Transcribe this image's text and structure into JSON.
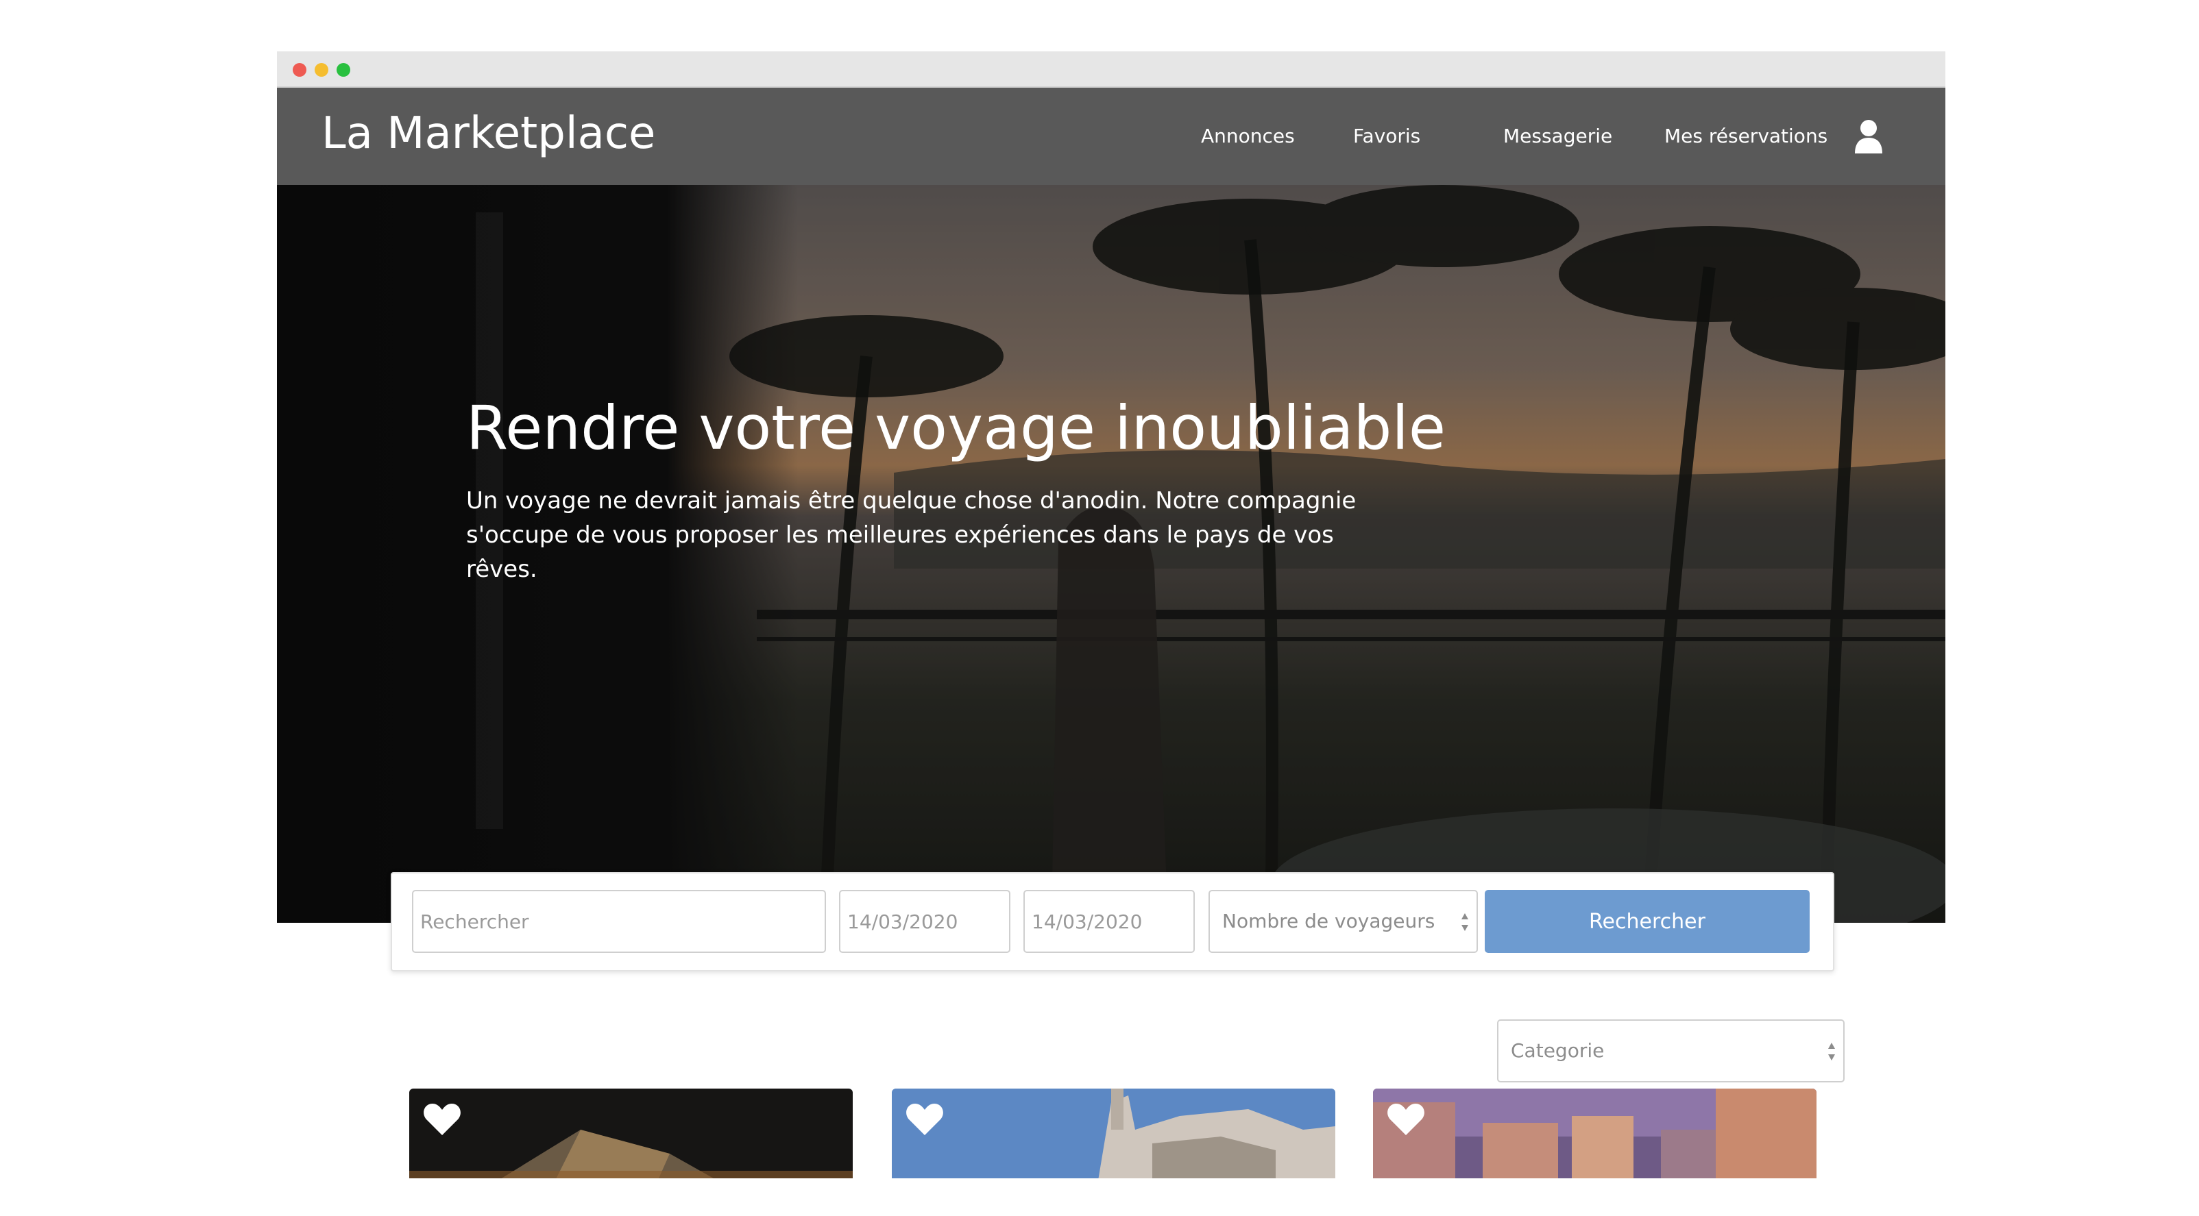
{
  "nav": {
    "brand": "La Marketplace",
    "links": [
      "Annonces",
      "Favoris",
      "Messagerie",
      "Mes réservations"
    ],
    "user_icon": "user-icon"
  },
  "hero": {
    "title": "Rendre votre voyage inoubliable",
    "text": "Un voyage ne devrait jamais être quelque chose d'anodin. Notre compagnie s'occupe de vous proposer les meilleures expériences dans le pays de vos rêves."
  },
  "search": {
    "query_placeholder": "Rechercher",
    "date_start": "14/03/2020",
    "date_end": "14/03/2020",
    "travellers_placeholder": "Nombre de voyageurs",
    "button_label": "Rechercher"
  },
  "filter": {
    "category_placeholder": "Categorie"
  },
  "cards": [
    {
      "favorite_icon": "heart-icon"
    },
    {
      "favorite_icon": "heart-icon"
    },
    {
      "favorite_icon": "heart-icon"
    }
  ],
  "colors": {
    "navbar": "#595959",
    "accent_button": "#6d9bd0",
    "titlebar": "#e6e6e6"
  }
}
